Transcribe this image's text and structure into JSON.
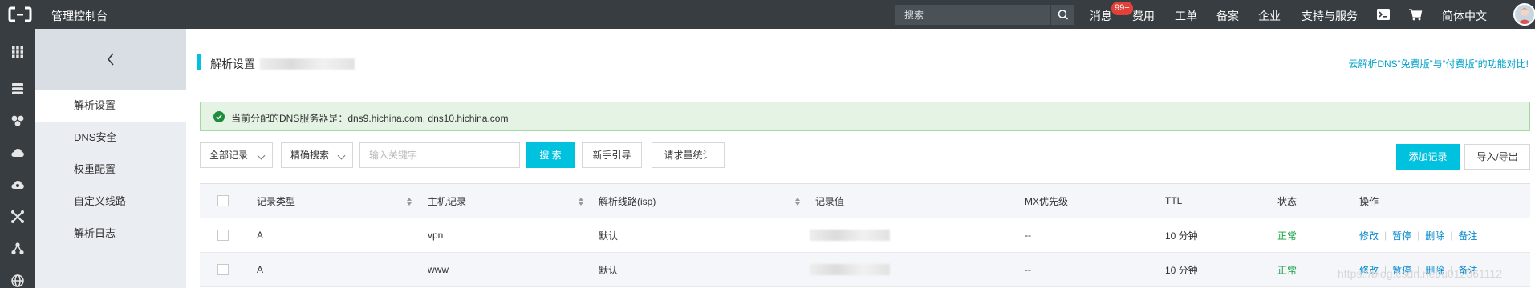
{
  "topbar": {
    "title": "管理控制台",
    "search_placeholder": "搜索",
    "nav": [
      "消息",
      "费用",
      "工单",
      "备案",
      "企业",
      "支持与服务"
    ],
    "msg_badge": "99+",
    "language": "简体中文"
  },
  "subnav": {
    "items": [
      "解析设置",
      "DNS安全",
      "权重配置",
      "自定义线路",
      "解析日志"
    ],
    "active_index": 0
  },
  "page": {
    "title": "解析设置",
    "compare_link": "云解析DNS“免费版”与“付费版”的功能对比!"
  },
  "alert": {
    "text": "当前分配的DNS服务器是：dns9.hichina.com, dns10.hichina.com"
  },
  "toolbar": {
    "record_filter": "全部记录",
    "search_mode": "精确搜索",
    "keyword_placeholder": "输入关键字",
    "search_btn": "搜 索",
    "guide_btn": "新手引导",
    "stats_btn": "请求量统计",
    "add_btn": "添加记录",
    "import_btn": "导入/导出"
  },
  "table": {
    "columns": [
      "记录类型",
      "主机记录",
      "解析线路(isp)",
      "记录值",
      "MX优先级",
      "TTL",
      "状态",
      "操作"
    ],
    "rows": [
      {
        "type": "A",
        "host": "vpn",
        "line": "默认",
        "mx": "--",
        "ttl": "10 分钟",
        "status": "正常"
      },
      {
        "type": "A",
        "host": "www",
        "line": "默认",
        "mx": "--",
        "ttl": "10 分钟",
        "status": "正常"
      }
    ],
    "ops": [
      "修改",
      "暂停",
      "删除",
      "备注"
    ]
  },
  "watermark": "https://blog.csdn.net/u012361112",
  "colors": {
    "accent": "#00c1de",
    "topbar": "#373d41",
    "link": "#0088cc",
    "ok": "#1aa34a"
  }
}
